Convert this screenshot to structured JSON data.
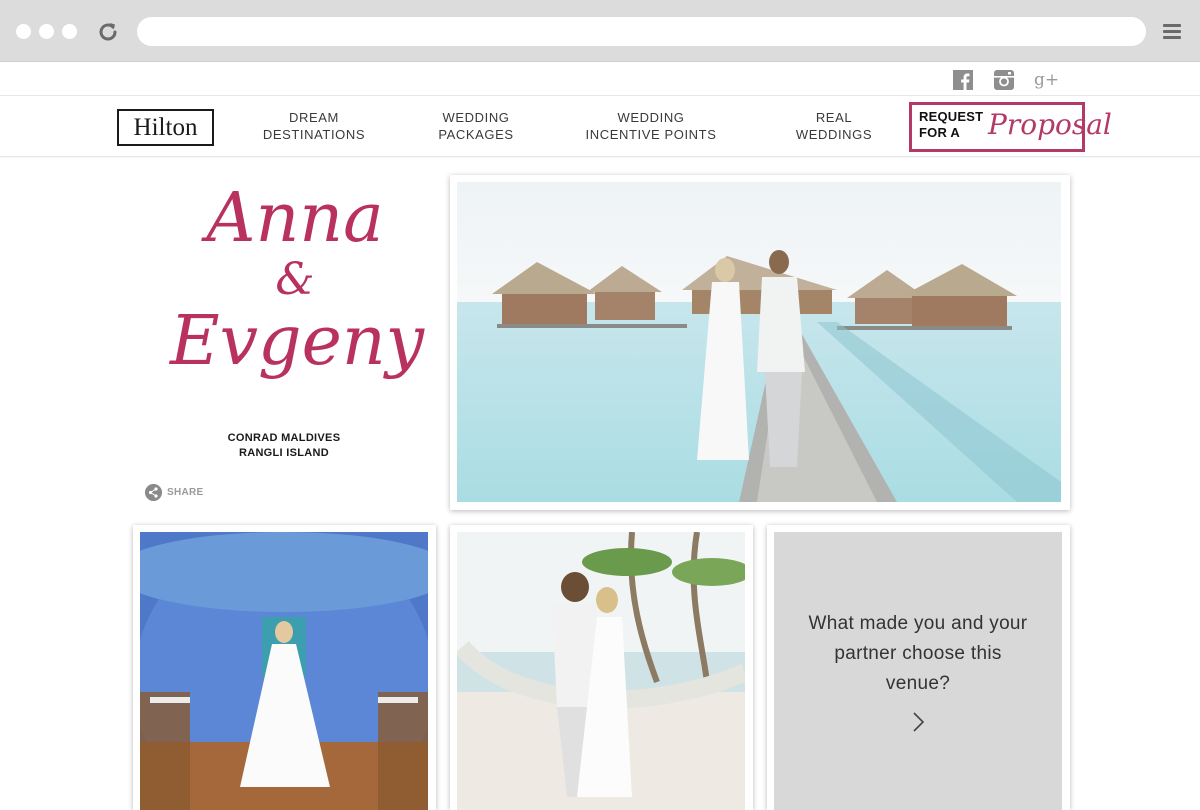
{
  "browser": {
    "icons": [
      "window-dot",
      "reload-icon",
      "hamburger-menu-icon"
    ]
  },
  "social": {
    "icons": [
      "facebook-icon",
      "instagram-icon",
      "google-plus-icon"
    ],
    "gplus_label": "g+"
  },
  "nav": {
    "logo": "Hilton",
    "items": [
      {
        "line1": "DREAM",
        "line2": "DESTINATIONS"
      },
      {
        "line1": "WEDDING",
        "line2": "PACKAGES"
      },
      {
        "line1": "WEDDING",
        "line2": "INCENTIVE POINTS"
      },
      {
        "line1": "REAL",
        "line2": "WEDDINGS"
      }
    ],
    "cta": {
      "line1": "REQUEST",
      "line2": "FOR A",
      "script": "Proposal"
    }
  },
  "intro": {
    "name1": "Anna",
    "ampersand": "&",
    "name2": "Evgeny",
    "venue_line1": "CONRAD MALDIVES",
    "venue_line2": "RANGLI ISLAND",
    "share_label": "SHARE"
  },
  "question": {
    "text": "What made you and your partner choose this venue?"
  },
  "colors": {
    "accent": "#b8315f",
    "chrome": "#dcdcdc",
    "question_bg": "#d8d8d8"
  }
}
